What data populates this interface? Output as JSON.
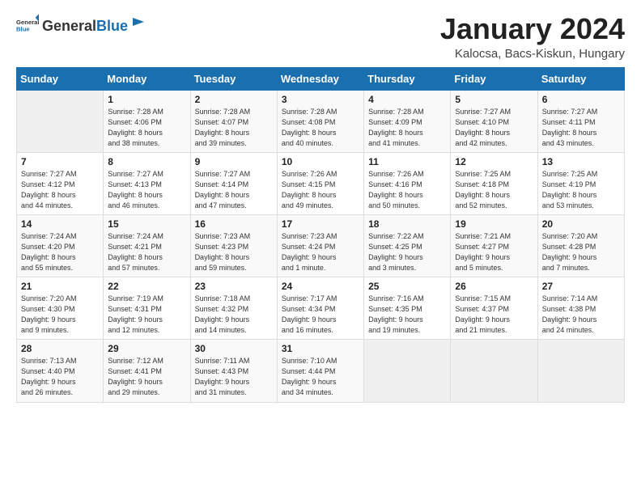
{
  "header": {
    "logo_general": "General",
    "logo_blue": "Blue",
    "title": "January 2024",
    "subtitle": "Kalocsa, Bacs-Kiskun, Hungary"
  },
  "weekdays": [
    "Sunday",
    "Monday",
    "Tuesday",
    "Wednesday",
    "Thursday",
    "Friday",
    "Saturday"
  ],
  "weeks": [
    [
      {
        "day": "",
        "info": ""
      },
      {
        "day": "1",
        "info": "Sunrise: 7:28 AM\nSunset: 4:06 PM\nDaylight: 8 hours\nand 38 minutes."
      },
      {
        "day": "2",
        "info": "Sunrise: 7:28 AM\nSunset: 4:07 PM\nDaylight: 8 hours\nand 39 minutes."
      },
      {
        "day": "3",
        "info": "Sunrise: 7:28 AM\nSunset: 4:08 PM\nDaylight: 8 hours\nand 40 minutes."
      },
      {
        "day": "4",
        "info": "Sunrise: 7:28 AM\nSunset: 4:09 PM\nDaylight: 8 hours\nand 41 minutes."
      },
      {
        "day": "5",
        "info": "Sunrise: 7:27 AM\nSunset: 4:10 PM\nDaylight: 8 hours\nand 42 minutes."
      },
      {
        "day": "6",
        "info": "Sunrise: 7:27 AM\nSunset: 4:11 PM\nDaylight: 8 hours\nand 43 minutes."
      }
    ],
    [
      {
        "day": "7",
        "info": "Sunrise: 7:27 AM\nSunset: 4:12 PM\nDaylight: 8 hours\nand 44 minutes."
      },
      {
        "day": "8",
        "info": "Sunrise: 7:27 AM\nSunset: 4:13 PM\nDaylight: 8 hours\nand 46 minutes."
      },
      {
        "day": "9",
        "info": "Sunrise: 7:27 AM\nSunset: 4:14 PM\nDaylight: 8 hours\nand 47 minutes."
      },
      {
        "day": "10",
        "info": "Sunrise: 7:26 AM\nSunset: 4:15 PM\nDaylight: 8 hours\nand 49 minutes."
      },
      {
        "day": "11",
        "info": "Sunrise: 7:26 AM\nSunset: 4:16 PM\nDaylight: 8 hours\nand 50 minutes."
      },
      {
        "day": "12",
        "info": "Sunrise: 7:25 AM\nSunset: 4:18 PM\nDaylight: 8 hours\nand 52 minutes."
      },
      {
        "day": "13",
        "info": "Sunrise: 7:25 AM\nSunset: 4:19 PM\nDaylight: 8 hours\nand 53 minutes."
      }
    ],
    [
      {
        "day": "14",
        "info": "Sunrise: 7:24 AM\nSunset: 4:20 PM\nDaylight: 8 hours\nand 55 minutes."
      },
      {
        "day": "15",
        "info": "Sunrise: 7:24 AM\nSunset: 4:21 PM\nDaylight: 8 hours\nand 57 minutes."
      },
      {
        "day": "16",
        "info": "Sunrise: 7:23 AM\nSunset: 4:23 PM\nDaylight: 8 hours\nand 59 minutes."
      },
      {
        "day": "17",
        "info": "Sunrise: 7:23 AM\nSunset: 4:24 PM\nDaylight: 9 hours\nand 1 minute."
      },
      {
        "day": "18",
        "info": "Sunrise: 7:22 AM\nSunset: 4:25 PM\nDaylight: 9 hours\nand 3 minutes."
      },
      {
        "day": "19",
        "info": "Sunrise: 7:21 AM\nSunset: 4:27 PM\nDaylight: 9 hours\nand 5 minutes."
      },
      {
        "day": "20",
        "info": "Sunrise: 7:20 AM\nSunset: 4:28 PM\nDaylight: 9 hours\nand 7 minutes."
      }
    ],
    [
      {
        "day": "21",
        "info": "Sunrise: 7:20 AM\nSunset: 4:30 PM\nDaylight: 9 hours\nand 9 minutes."
      },
      {
        "day": "22",
        "info": "Sunrise: 7:19 AM\nSunset: 4:31 PM\nDaylight: 9 hours\nand 12 minutes."
      },
      {
        "day": "23",
        "info": "Sunrise: 7:18 AM\nSunset: 4:32 PM\nDaylight: 9 hours\nand 14 minutes."
      },
      {
        "day": "24",
        "info": "Sunrise: 7:17 AM\nSunset: 4:34 PM\nDaylight: 9 hours\nand 16 minutes."
      },
      {
        "day": "25",
        "info": "Sunrise: 7:16 AM\nSunset: 4:35 PM\nDaylight: 9 hours\nand 19 minutes."
      },
      {
        "day": "26",
        "info": "Sunrise: 7:15 AM\nSunset: 4:37 PM\nDaylight: 9 hours\nand 21 minutes."
      },
      {
        "day": "27",
        "info": "Sunrise: 7:14 AM\nSunset: 4:38 PM\nDaylight: 9 hours\nand 24 minutes."
      }
    ],
    [
      {
        "day": "28",
        "info": "Sunrise: 7:13 AM\nSunset: 4:40 PM\nDaylight: 9 hours\nand 26 minutes."
      },
      {
        "day": "29",
        "info": "Sunrise: 7:12 AM\nSunset: 4:41 PM\nDaylight: 9 hours\nand 29 minutes."
      },
      {
        "day": "30",
        "info": "Sunrise: 7:11 AM\nSunset: 4:43 PM\nDaylight: 9 hours\nand 31 minutes."
      },
      {
        "day": "31",
        "info": "Sunrise: 7:10 AM\nSunset: 4:44 PM\nDaylight: 9 hours\nand 34 minutes."
      },
      {
        "day": "",
        "info": ""
      },
      {
        "day": "",
        "info": ""
      },
      {
        "day": "",
        "info": ""
      }
    ]
  ]
}
